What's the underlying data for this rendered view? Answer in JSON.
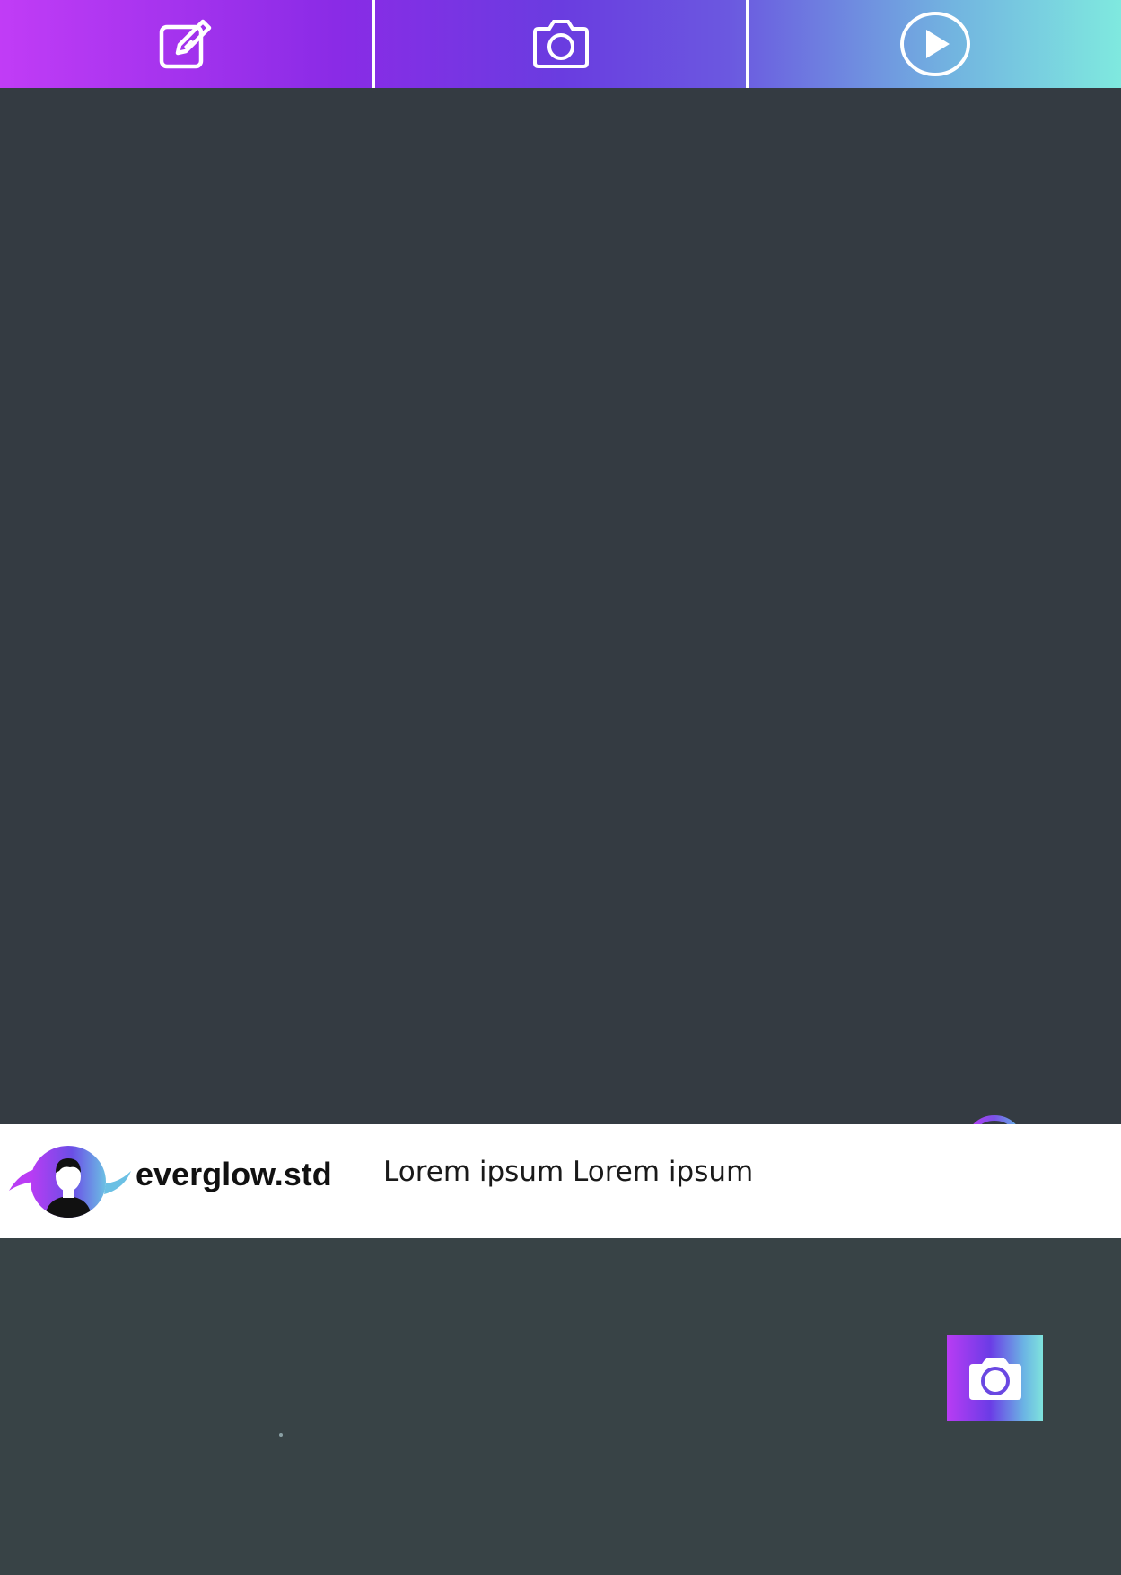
{
  "tabs": [
    {
      "name": "edit",
      "icon": "edit-icon"
    },
    {
      "name": "camera",
      "icon": "camera-icon"
    },
    {
      "name": "video",
      "icon": "play-icon"
    }
  ],
  "profile": {
    "username": "everglow.std",
    "caption": "Lorem ipsum Lorem ipsum",
    "avatar_icon": "user-avatar-icon"
  },
  "colors": {
    "gradient_start": "#c13cf6",
    "gradient_mid": "#6a3ce0",
    "gradient_end": "#7fe9df",
    "photo_background": "#343b42",
    "bottom_background": "#384346"
  },
  "icons": {
    "loading": "refresh-icon",
    "camera_button": "camera-icon"
  }
}
